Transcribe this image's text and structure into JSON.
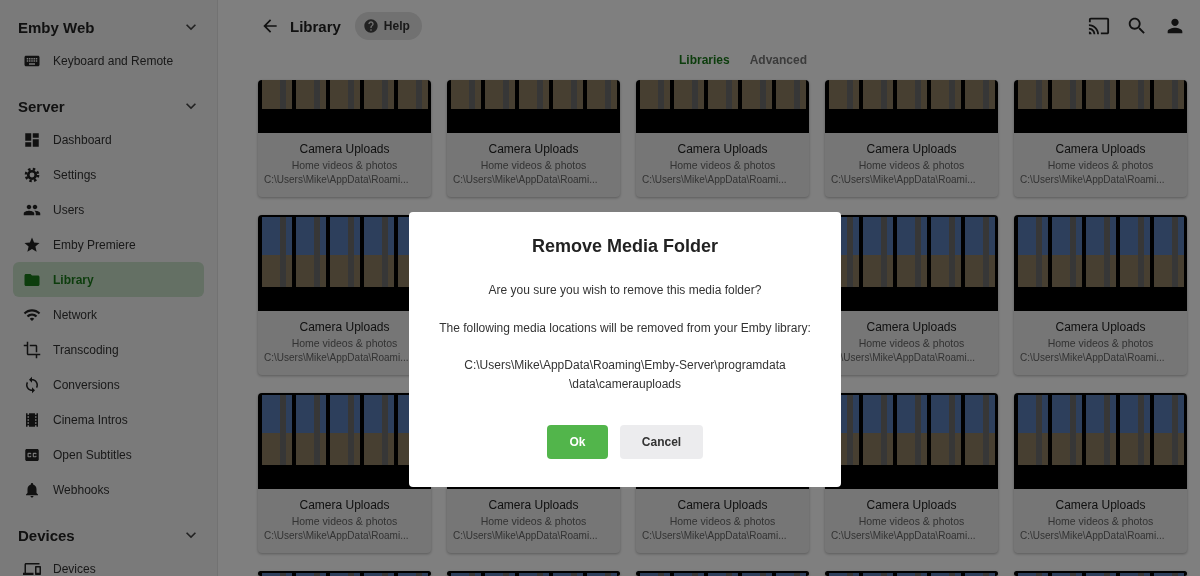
{
  "sidebar": {
    "sections": [
      {
        "title": "Emby Web",
        "items": [
          {
            "label": "Keyboard and Remote",
            "selected": false
          }
        ]
      },
      {
        "title": "Server",
        "items": [
          {
            "label": "Dashboard",
            "selected": false
          },
          {
            "label": "Settings",
            "selected": false
          },
          {
            "label": "Users",
            "selected": false
          },
          {
            "label": "Emby Premiere",
            "selected": false
          },
          {
            "label": "Library",
            "selected": true
          },
          {
            "label": "Network",
            "selected": false
          },
          {
            "label": "Transcoding",
            "selected": false
          },
          {
            "label": "Conversions",
            "selected": false
          },
          {
            "label": "Cinema Intros",
            "selected": false
          },
          {
            "label": "Open Subtitles",
            "selected": false
          },
          {
            "label": "Webhooks",
            "selected": false
          }
        ]
      },
      {
        "title": "Devices",
        "items": [
          {
            "label": "Devices",
            "selected": false
          }
        ]
      }
    ]
  },
  "header": {
    "title": "Library",
    "help": "Help"
  },
  "tabs": [
    {
      "label": "Libraries",
      "selected": true
    },
    {
      "label": "Advanced",
      "selected": false
    }
  ],
  "card_rows": [
    [
      {
        "kind": "top-cut",
        "title": "Camera Uploads",
        "subtitle": "Home videos & photos",
        "path": "C:\\Users\\Mike\\AppData\\Roami..."
      },
      {
        "kind": "top-cut",
        "title": "Camera Uploads",
        "subtitle": "Home videos & photos",
        "path": "C:\\Users\\Mike\\AppData\\Roami..."
      },
      {
        "kind": "top-cut",
        "title": "Camera Uploads",
        "subtitle": "Home videos & photos",
        "path": "C:\\Users\\Mike\\AppData\\Roami..."
      },
      {
        "kind": "top-cut",
        "title": "Camera Uploads",
        "subtitle": "Home videos & photos",
        "path": "C:\\Users\\Mike\\AppData\\Roami..."
      },
      {
        "kind": "top-cut",
        "title": "Camera Uploads",
        "subtitle": "Home videos & photos",
        "path": "C:\\Users\\Mike\\AppData\\Roami..."
      }
    ],
    [
      {
        "kind": "full",
        "title": "Camera Uploads",
        "subtitle": "Home videos & photos",
        "path": "C:\\Users\\Mike\\AppData\\Roami..."
      },
      {
        "kind": "covered"
      },
      {
        "kind": "covered"
      },
      {
        "kind": "left-covered",
        "title": "Camera Uploads",
        "subtitle": "Home videos & photos",
        "path": "\\Users\\Mike\\AppData\\Roami..."
      },
      {
        "kind": "full",
        "title": "Camera Uploads",
        "subtitle": "Home videos & photos",
        "path": "C:\\Users\\Mike\\AppData\\Roami..."
      }
    ],
    [
      {
        "kind": "full",
        "title": "Camera Uploads",
        "subtitle": "Home videos & photos",
        "path": "C:\\Users\\Mike\\AppData\\Roami..."
      },
      {
        "kind": "full",
        "title": "Camera Uploads",
        "subtitle": "Home videos & photos",
        "path": "C:\\Users\\Mike\\AppData\\Roami..."
      },
      {
        "kind": "full",
        "title": "Camera Uploads",
        "subtitle": "Home videos & photos",
        "path": "C:\\Users\\Mike\\AppData\\Roami..."
      },
      {
        "kind": "full",
        "title": "Camera Uploads",
        "subtitle": "Home videos & photos",
        "path": "C:\\Users\\Mike\\AppData\\Roami..."
      },
      {
        "kind": "full",
        "title": "Camera Uploads",
        "subtitle": "Home videos & photos",
        "path": "C:\\Users\\Mike\\AppData\\Roami..."
      }
    ],
    [
      {
        "kind": "peek"
      },
      {
        "kind": "peek"
      },
      {
        "kind": "peek"
      },
      {
        "kind": "peek"
      },
      {
        "kind": "peek"
      }
    ]
  ],
  "dialog": {
    "title": "Remove Media Folder",
    "question": "Are you sure you wish to remove this media folder?",
    "notice": "The following media locations will be removed from your Emby library:",
    "path_lines": [
      "C:\\Users\\Mike\\AppData\\Roaming\\Emby-Server\\programdata",
      "\\data\\camerauploads"
    ],
    "buttons": [
      {
        "label": "Ok",
        "kind": "primary"
      },
      {
        "label": "Cancel",
        "kind": "secondary"
      }
    ]
  }
}
